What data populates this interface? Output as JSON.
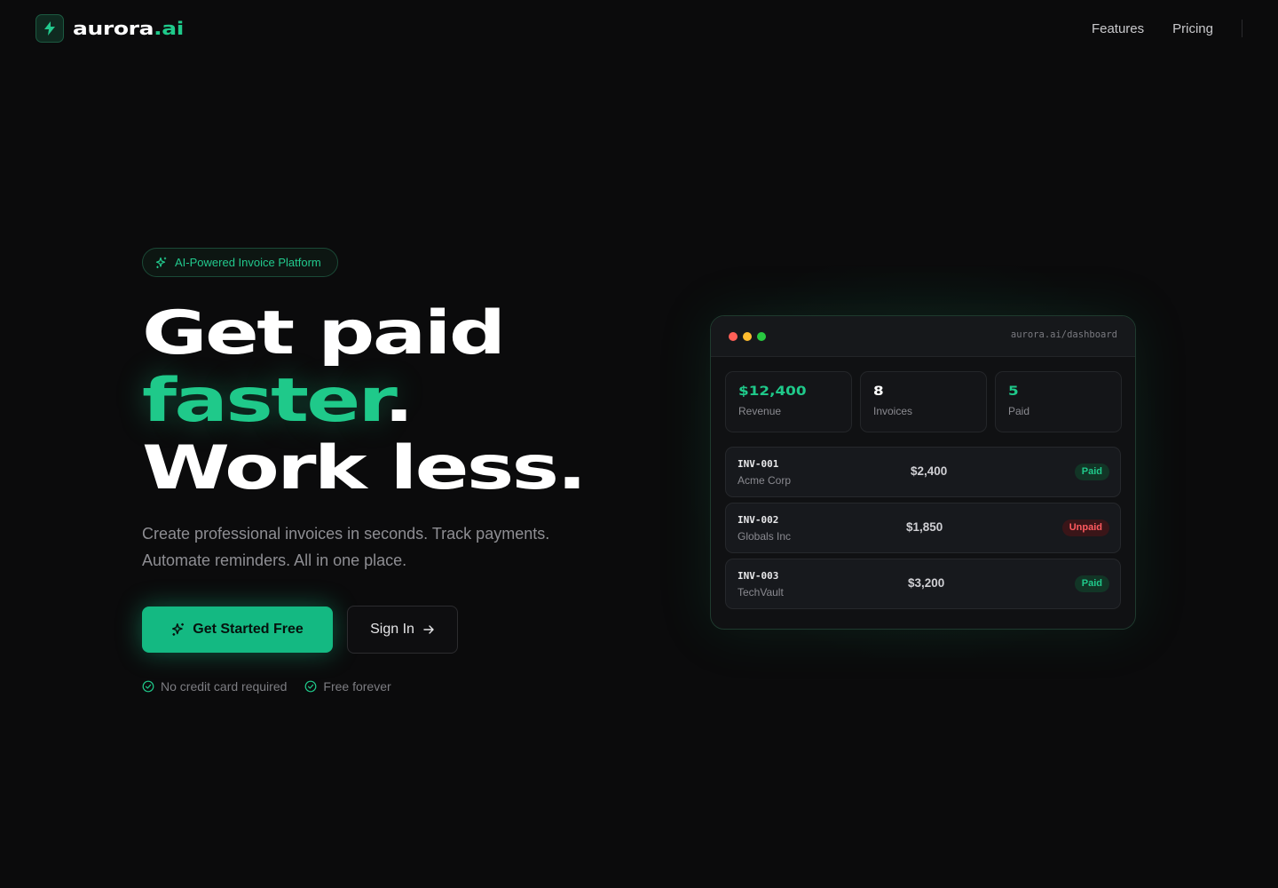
{
  "brand": {
    "name_base": "aurora",
    "name_tld": ".ai",
    "accent": "#1fc98a"
  },
  "nav": {
    "links": [
      "Features",
      "Pricing"
    ]
  },
  "hero": {
    "badge": "AI-Powered Invoice Platform",
    "headline": {
      "line1": "Get paid",
      "line2_accent": "faster",
      "line2_end": ".",
      "line3": "Work less."
    },
    "subtitle_line1": "Create professional invoices in seconds. Track payments.",
    "subtitle_line2": "Automate reminders. All in one place.",
    "primary_cta": "Get Started Free",
    "secondary_cta": "Sign In",
    "perks": [
      "No credit card required",
      "Free forever"
    ]
  },
  "dashboard": {
    "url": "aurora.ai/dashboard",
    "stats": [
      {
        "value": "$12,400",
        "label": "Revenue",
        "color": "#1fc98a"
      },
      {
        "value": "8",
        "label": "Invoices",
        "color": "#ffffff"
      },
      {
        "value": "5",
        "label": "Paid",
        "color": "#1fc98a"
      }
    ],
    "invoices": [
      {
        "id": "INV-001",
        "client": "Acme Corp",
        "amount": "$2,400",
        "status": "Paid"
      },
      {
        "id": "INV-002",
        "client": "Globals Inc",
        "amount": "$1,850",
        "status": "Unpaid"
      },
      {
        "id": "INV-003",
        "client": "TechVault",
        "amount": "$3,200",
        "status": "Paid"
      }
    ]
  }
}
